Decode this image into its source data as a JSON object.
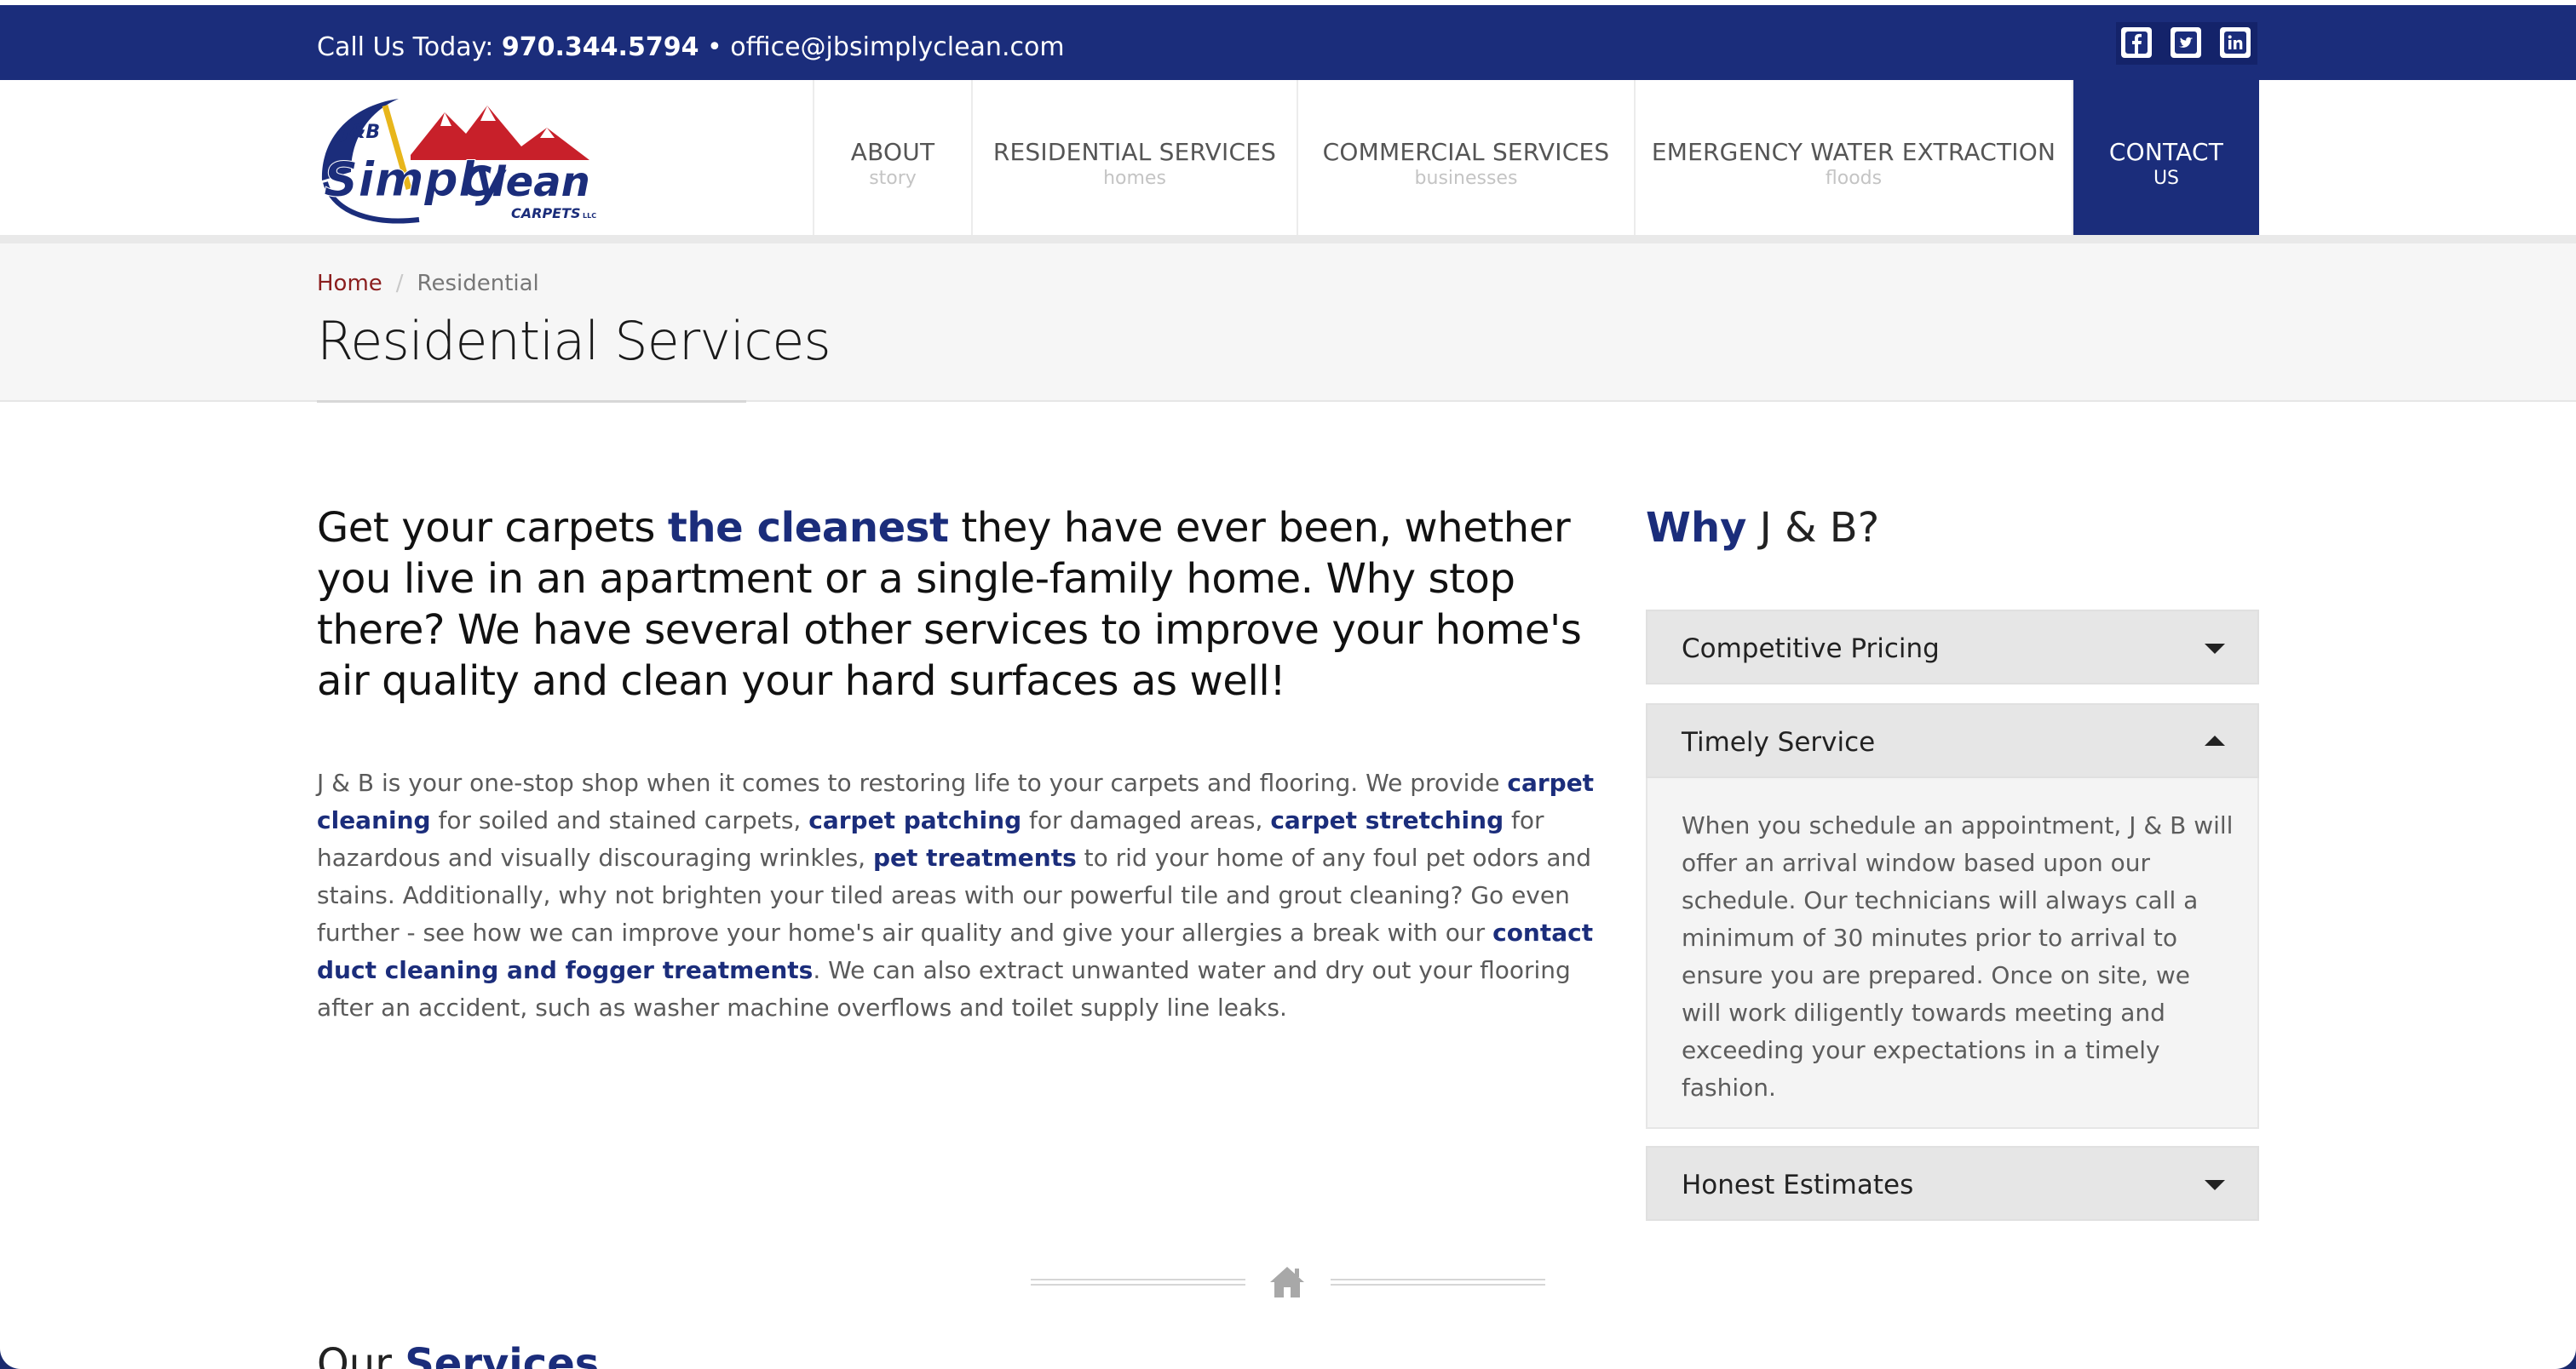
{
  "topbar": {
    "call_label": "Call Us Today:",
    "phone": "970.344.5794",
    "separator": "•",
    "email": "office@jbsimplyclean.com",
    "social": [
      "facebook-icon",
      "twitter-icon",
      "linkedin-icon"
    ]
  },
  "logo": {
    "top": "J&B",
    "name_a": "Simply",
    "name_b": "Clean",
    "sub": "CARPETS",
    "llc": "LLC"
  },
  "nav": [
    {
      "main": "ABOUT",
      "sub": "story"
    },
    {
      "main": "RESIDENTIAL SERVICES",
      "sub": "homes"
    },
    {
      "main": "COMMERCIAL SERVICES",
      "sub": "businesses"
    },
    {
      "main": "EMERGENCY WATER EXTRACTION",
      "sub": "floods"
    },
    {
      "main": "CONTACT",
      "sub": "US"
    }
  ],
  "breadcrumb": {
    "home": "Home",
    "separator": "/",
    "current": "Residential"
  },
  "page_title": "Residential Services",
  "lead": {
    "a": "Get your carpets ",
    "b": "the cleanest",
    "c": " they have ever been, whether you live in an apartment or a single-family home. Why stop there? We have several other services to improve your home's air quality and clean your hard surfaces as well!"
  },
  "body": {
    "t1": "J & B is your one-stop shop when it comes to restoring life to your carpets and flooring. We provide ",
    "l1": "carpet cleaning",
    "t2": " for soiled and stained carpets, ",
    "l2": "carpet patching",
    "t3": " for damaged areas, ",
    "l3": "carpet stretching",
    "t4": " for hazardous and visually discouraging wrinkles, ",
    "l4": "pet treatments",
    "t5": " to rid your home of any foul pet odors and stains. Additionally, why not brighten your tiled areas with our powerful tile and grout cleaning? Go even further - see how we can improve your home's air quality and give your allergies a break with our ",
    "l5": "contact duct cleaning and fogger treatments",
    "t6": ". We can also extract unwanted water and dry out your flooring after an accident, such as washer machine overflows and toilet supply line leaks."
  },
  "why": {
    "bold": "Why",
    "rest": " J & B?"
  },
  "accordion": [
    {
      "label": "Competitive Pricing",
      "open": false
    },
    {
      "label": "Timely Service",
      "open": true,
      "content": "When you schedule an appointment, J & B will offer an arrival window based upon our schedule. Our technicians will always call a minimum of 30 minutes prior to arrival to ensure you are prepared. Once on site, we will work diligently towards meeting and exceeding your expectations in a timely fashion."
    },
    {
      "label": "Honest Estimates",
      "open": false
    }
  ],
  "services_heading": {
    "a": "Our ",
    "b": "Services"
  },
  "colors": {
    "brand_blue": "#1b2d7b",
    "breadcrumb_red": "#8b1e1e"
  }
}
